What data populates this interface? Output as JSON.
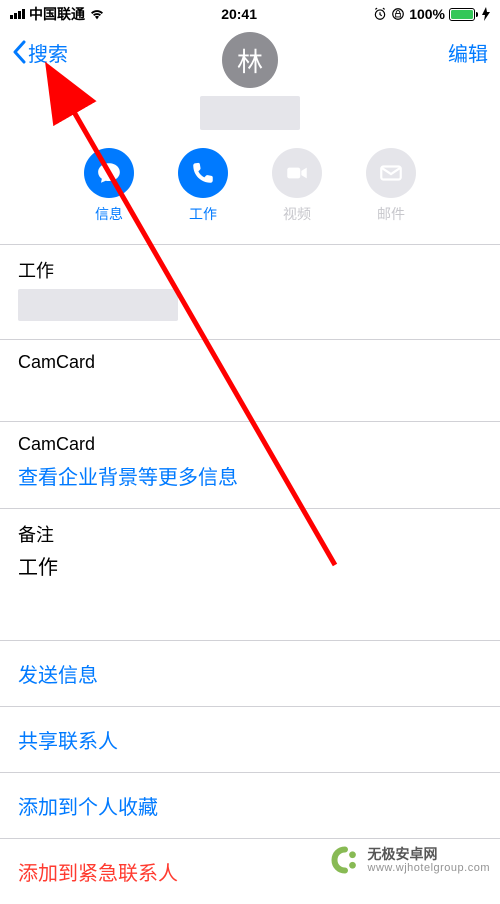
{
  "status": {
    "carrier": "中国联通",
    "time": "20:41",
    "battery_pct": "100%"
  },
  "nav": {
    "back_label": "搜索",
    "edit_label": "编辑"
  },
  "avatar_initial": "林",
  "actions": {
    "message": "信息",
    "call": "工作",
    "video": "视频",
    "mail": "邮件"
  },
  "fields": {
    "phone_label": "工作",
    "camcard1": "CamCard",
    "camcard2": "CamCard",
    "company_info_link": "查看企业背景等更多信息",
    "notes_label": "备注",
    "notes_value": "工作"
  },
  "cells": {
    "send_message": "发送信息",
    "share_contact": "共享联系人",
    "add_favorites": "添加到个人收藏",
    "add_emergency": "添加到紧急联系人"
  },
  "watermark": {
    "title": "无极安卓网",
    "url": "www.wjhotelgroup.com"
  }
}
